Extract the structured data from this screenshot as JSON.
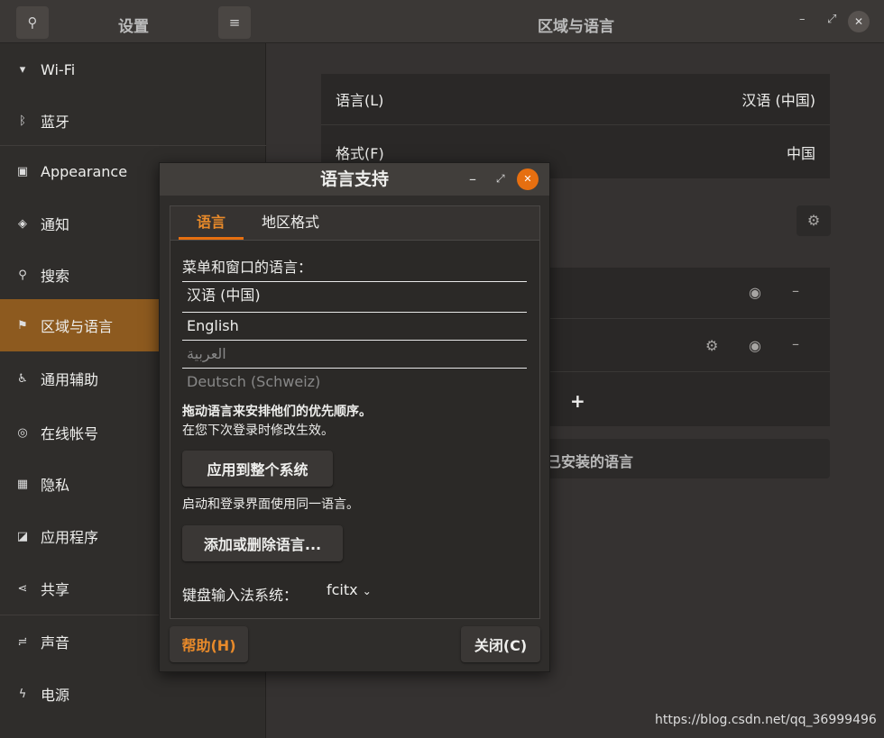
{
  "header": {
    "left_title": "设置",
    "right_title": "区域与语言",
    "search_icon": "search-icon",
    "menu_icon": "hamburger-icon"
  },
  "sidebar": {
    "items": [
      {
        "label": "Wi-Fi",
        "icon": "▾"
      },
      {
        "label": "蓝牙",
        "icon": "ᛒ"
      },
      {
        "label": "Appearance",
        "icon": "▣"
      },
      {
        "label": "通知",
        "icon": "◈"
      },
      {
        "label": "搜索",
        "icon": "⚲"
      },
      {
        "label": "区域与语言",
        "icon": "⚑"
      },
      {
        "label": "通用辅助",
        "icon": "♿"
      },
      {
        "label": "在线帐号",
        "icon": "◎"
      },
      {
        "label": "隐私",
        "icon": "▦"
      },
      {
        "label": "应用程序",
        "icon": "◪"
      },
      {
        "label": "共享",
        "icon": "⋖"
      },
      {
        "label": "声音",
        "icon": "≓"
      },
      {
        "label": "电源",
        "icon": "ϟ"
      }
    ],
    "selected": "区域与语言"
  },
  "main": {
    "language_label": "语言(L)",
    "language_value": "汉语 (中国)",
    "format_label": "格式(F)",
    "format_value": "中国",
    "installed_button": "已安装的语言"
  },
  "dialog": {
    "title": "语言支持",
    "tabs": [
      "语言",
      "地区格式"
    ],
    "active_tab": "语言",
    "menu_lang_label": "菜单和窗口的语言：",
    "languages": [
      "汉语 (中国)",
      "English",
      "العربية",
      "Deutsch (Schweiz)"
    ],
    "drag_hint": "拖动语言来安排他们的优先顺序。",
    "relogin_hint": "在您下次登录时修改生效。",
    "apply_button": "应用到整个系统",
    "apply_hint": "启动和登录界面使用同一语言。",
    "add_remove_button": "添加或删除语言...",
    "input_method_label": "键盘输入法系统：",
    "input_method_value": "fcitx",
    "help_button": "帮助(H)",
    "close_button": "关闭(C)"
  },
  "colors": {
    "accent": "#e66f10",
    "selected": "#8d5a1f"
  },
  "watermark": "https://blog.csdn.net/qq_36999496"
}
